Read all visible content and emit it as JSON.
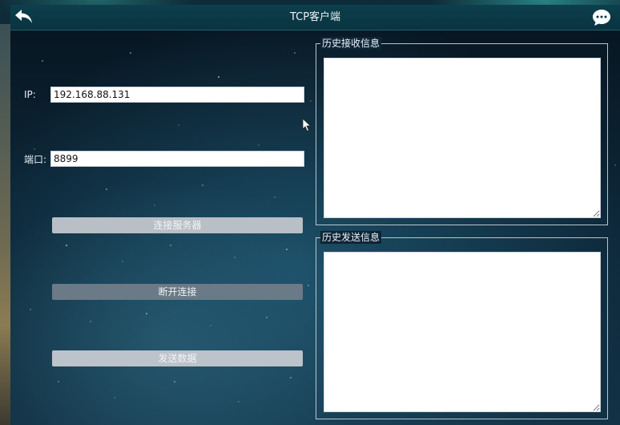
{
  "window": {
    "title": "TCP客户端"
  },
  "connection": {
    "ip_label": "IP:",
    "ip_value": "192.168.88.131",
    "port_label": "端口:",
    "port_value": "8899"
  },
  "buttons": {
    "connect_label": "连接服务器",
    "disconnect_label": "断开连接",
    "send_label": "发送数据"
  },
  "history": {
    "received_title": "历史接收信息",
    "sent_title": "历史发送信息"
  },
  "icons": {
    "back": "back-arrow-icon",
    "chat": "chat-bubble-icon"
  },
  "colors": {
    "titlebar": "#0d3f4c",
    "button_enabled": "#6a7a86",
    "button_disabled": "#b8bfc6"
  }
}
